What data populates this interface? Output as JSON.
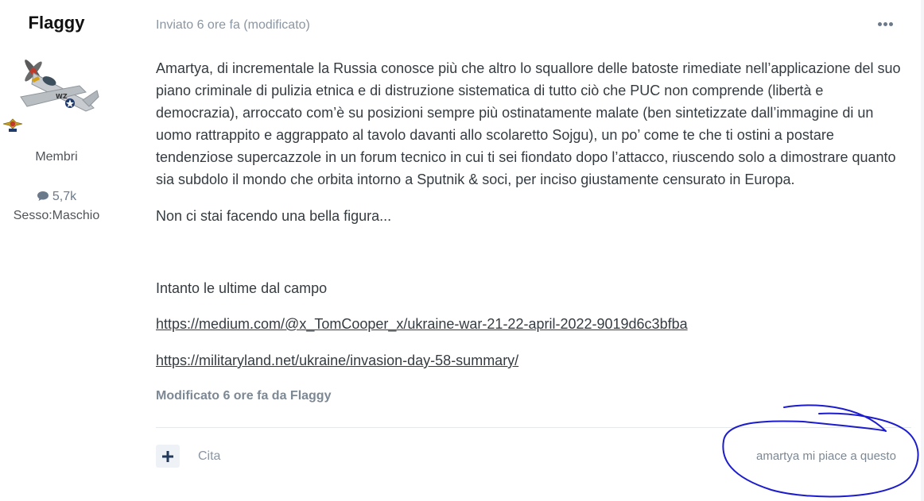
{
  "author": {
    "name": "Flaggy",
    "group": "Membri",
    "post_count": "5,7k",
    "gender": "Sesso:Maschio",
    "avatar_icon": "warplane-avatar-icon",
    "badge_icon": "rank-badge-icon",
    "post_count_icon": "comment-icon"
  },
  "post": {
    "meta": "Inviato 6 ore fa (modificato)",
    "more_icon": "ellipsis-icon",
    "paragraph_main": "Amartya, di incrementale la Russia conosce più che altro lo squallore delle batoste rimediate nell’applicazione del suo piano criminale di pulizia etnica e di distruzione sistematica di tutto ciò che PUC non comprende (libertà e democrazia), arroccato com’è su posizioni sempre più ostinatamente malate (ben sintetizzate dall’immagine di un uomo rattrappito e aggrappato al tavolo davanti allo scolaretto Sojgu), un po’ come te che ti ostini a postare tendenziose supercazzole in un forum tecnico in cui ti sei fiondato dopo l’attacco, riuscendo solo a dimostrare quanto sia subdolo il mondo che orbita intorno a Sputnik & soci, per inciso giustamente censurato in Europa.",
    "paragraph_figure": "Non ci stai facendo una bella figura...",
    "paragraph_intanto": "Intanto le ultime dal campo",
    "link_1": "https://medium.com/@x_TomCooper_x/ukraine-war-21-22-april-2022-9019d6c3bfba",
    "link_2": "https://militaryland.net/ukraine/invasion-day-58-summary/",
    "edited_note": "Modificato 6 ore fa da Flaggy"
  },
  "footer": {
    "plus_icon": "plus-icon",
    "quote_label": "Cita",
    "reaction_text": "amartya mi piace a questo"
  },
  "colors": {
    "text": "#353c41",
    "muted": "#8a96a2",
    "annotation": "#1c1ccc",
    "plus_bg": "#eef2f7"
  }
}
